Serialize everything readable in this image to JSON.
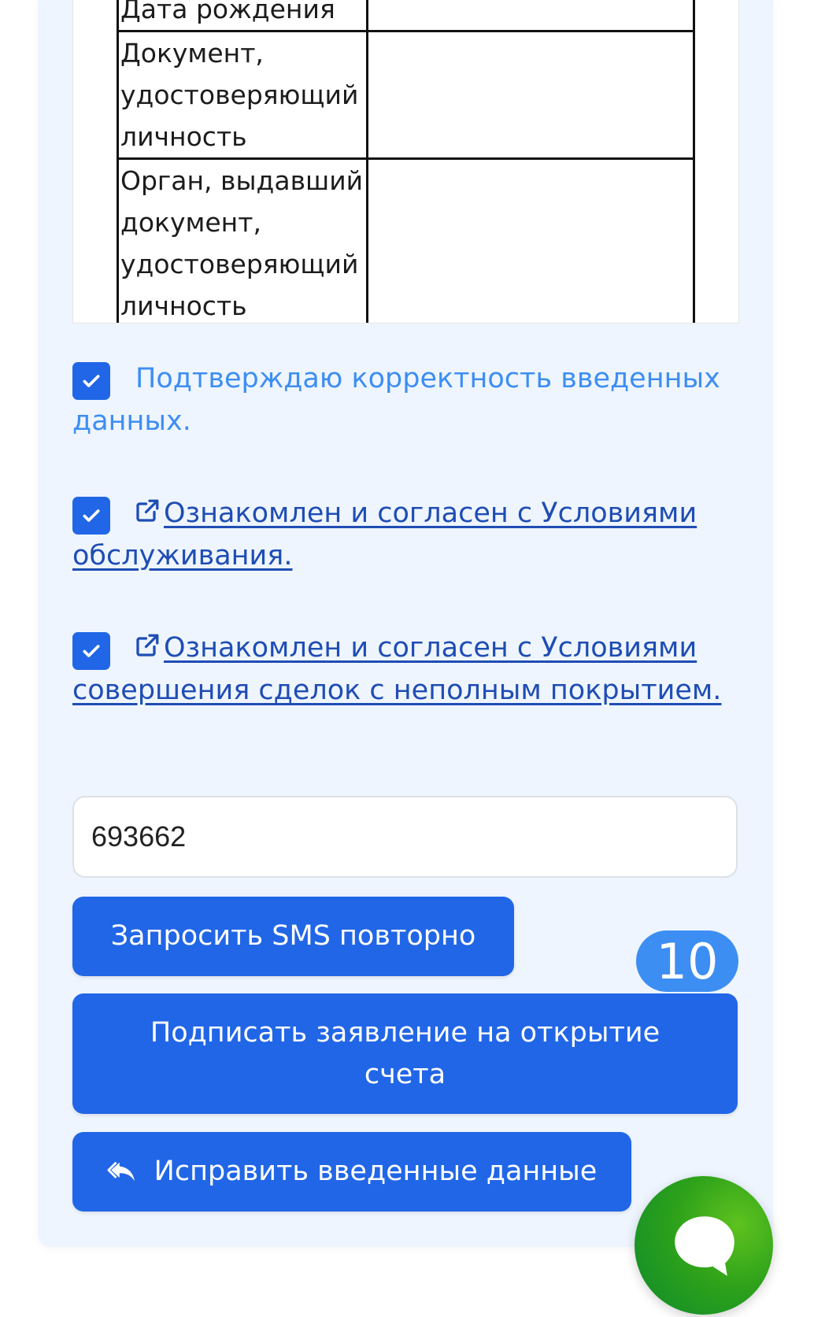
{
  "document_table": {
    "rows": [
      {
        "label": "Дата рождения",
        "value": ""
      },
      {
        "label": "Документ, удостоверяющий личность",
        "value": ""
      },
      {
        "label": "Орган, выдавший документ, удостоверяющий личность",
        "value": ""
      }
    ]
  },
  "agreements": {
    "confirm_label": "Подтверждаю корректность введенных данных.",
    "service_terms_link": "Ознакомлен и согласен с Условиями обслуживания.",
    "margin_terms_link": "Ознакомлен и согласен с Условиями совершения сделок с неполным покрытием."
  },
  "sms": {
    "code_value": "693662",
    "resend_button": "Запросить SMS повторно"
  },
  "actions": {
    "sign_button": "Подписать заявление на открытие счета",
    "edit_button": "Исправить введенные данные"
  },
  "badge": {
    "count": "10"
  },
  "icons": {
    "check": "check-icon",
    "external_link": "external-link-icon",
    "reply": "reply-icon",
    "chat": "chat-bubble-icon"
  },
  "colors": {
    "primary": "#2166e6",
    "link": "#1f4db4",
    "confirm_text": "#3d8ef2",
    "badge": "#3d8ef2",
    "chat": "#2ea21a",
    "card_bg": "#eef5fe"
  }
}
